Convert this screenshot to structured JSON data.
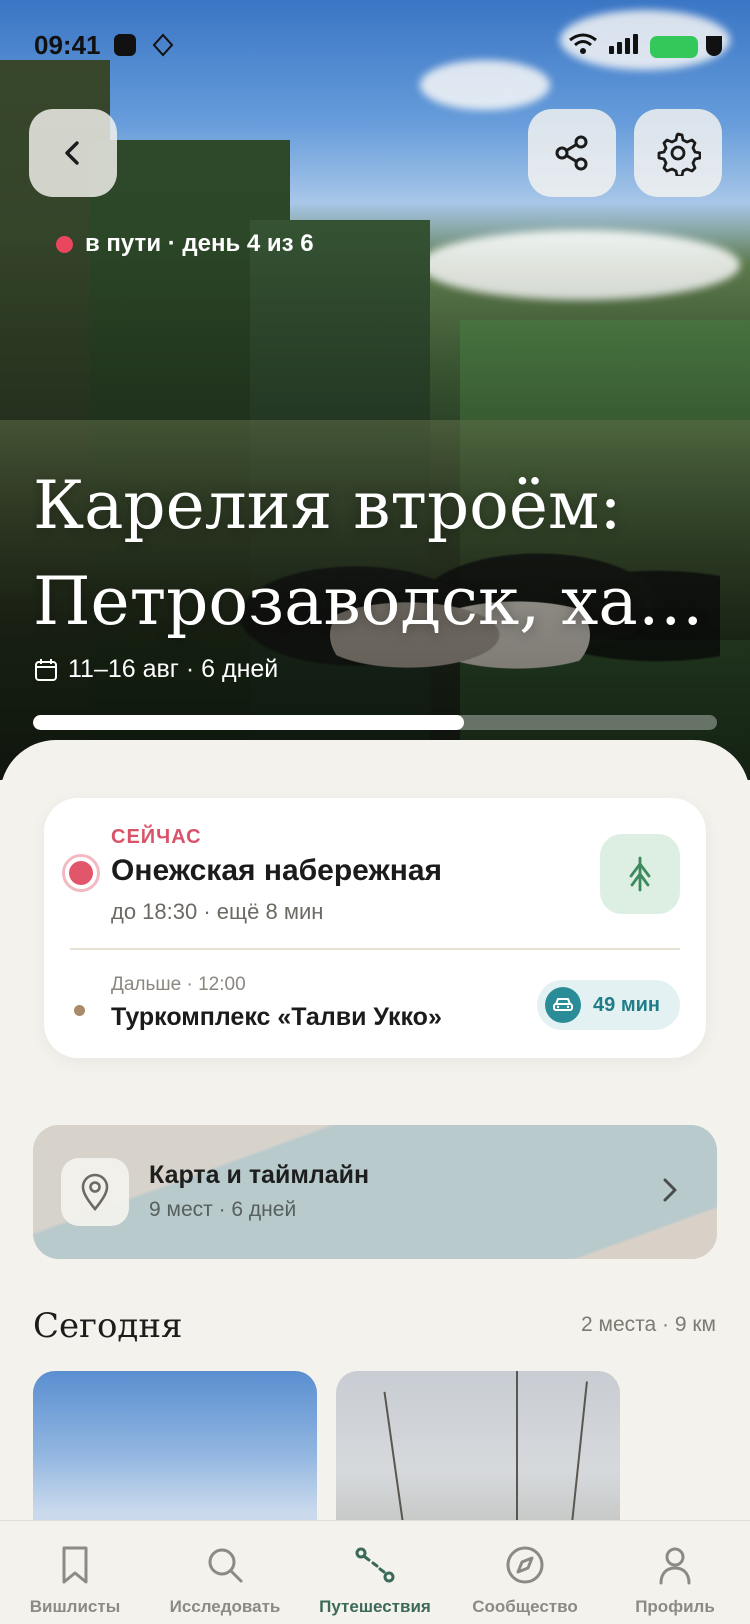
{
  "status_bar": {
    "time": "09:41"
  },
  "hero": {
    "status": "в пути · день 4 из 6",
    "title_line1": "Карелия втроём:",
    "title_line2": "Петрозаводск, ха…",
    "dates": "11–16 авг · 6 дней",
    "progress_fraction": 0.63
  },
  "now": {
    "kicker": "СЕЙЧАС",
    "title": "Онежская набережная",
    "subtitle": "до 18:30 · ещё 8 мин"
  },
  "next": {
    "meta": "Дальше · 12:00",
    "title": "Туркомплекс «Талви Укко»",
    "drive_time": "49 мин"
  },
  "map_card": {
    "title": "Карта и таймлайн",
    "subtitle": "9 мест · 6 дней"
  },
  "today": {
    "heading": "Сегодня",
    "meta": "2 места · 9 км"
  },
  "tabs": [
    {
      "label": "Вишлисты",
      "icon": "bookmark-icon"
    },
    {
      "label": "Исследовать",
      "icon": "search-icon"
    },
    {
      "label": "Путешествия",
      "icon": "route-icon"
    },
    {
      "label": "Сообщество",
      "icon": "compass-icon"
    },
    {
      "label": "Профиль",
      "icon": "person-icon"
    }
  ],
  "colors": {
    "accent_red": "#e2566b",
    "accent_green": "#3b6a5a",
    "teal": "#2a8c97",
    "background": "#f4f2ec"
  }
}
